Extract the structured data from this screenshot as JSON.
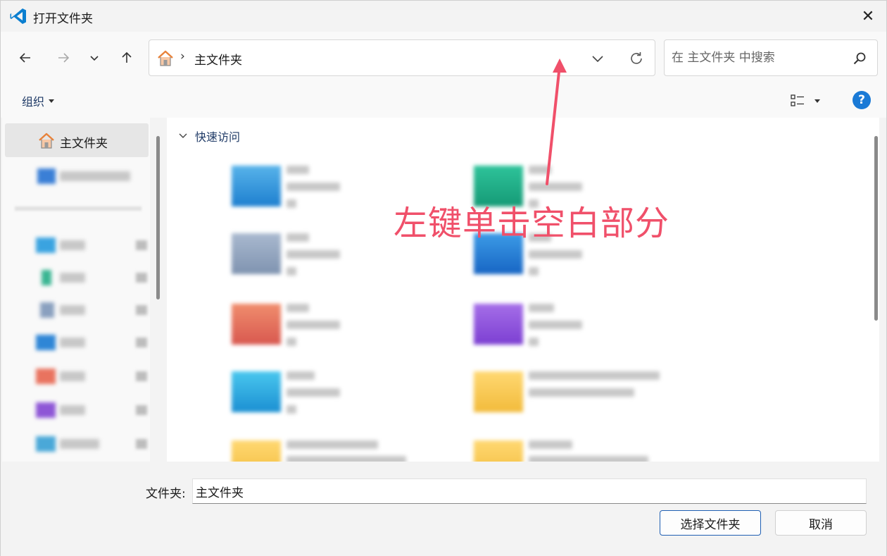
{
  "window": {
    "title": "打开文件夹",
    "close_label": "✕"
  },
  "address": {
    "separator": "›",
    "path": "主文件夹"
  },
  "search": {
    "placeholder": "在 主文件夹 中搜索"
  },
  "toolbar": {
    "organize_label": "组织",
    "help_label": "?"
  },
  "sidebar": {
    "home_label": "主文件夹"
  },
  "main": {
    "section_label": "快速访问"
  },
  "annotation": {
    "text": "左键单击空白部分"
  },
  "bottom": {
    "folder_label": "文件夹:",
    "folder_value": "主文件夹",
    "select_button": "选择文件夹",
    "cancel_button": "取消"
  },
  "colors": {
    "accent": "#1a7ad6",
    "annotation": "#f0506a",
    "home_icon": "#e8823a"
  }
}
